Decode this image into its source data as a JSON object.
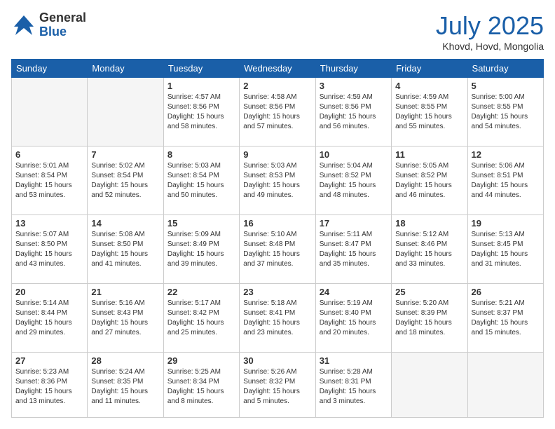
{
  "logo": {
    "general": "General",
    "blue": "Blue"
  },
  "header": {
    "month": "July 2025",
    "location": "Khovd, Hovd, Mongolia"
  },
  "weekdays": [
    "Sunday",
    "Monday",
    "Tuesday",
    "Wednesday",
    "Thursday",
    "Friday",
    "Saturday"
  ],
  "weeks": [
    [
      {
        "day": "",
        "sunrise": "",
        "sunset": "",
        "daylight": ""
      },
      {
        "day": "",
        "sunrise": "",
        "sunset": "",
        "daylight": ""
      },
      {
        "day": "1",
        "sunrise": "Sunrise: 4:57 AM",
        "sunset": "Sunset: 8:56 PM",
        "daylight": "Daylight: 15 hours and 58 minutes."
      },
      {
        "day": "2",
        "sunrise": "Sunrise: 4:58 AM",
        "sunset": "Sunset: 8:56 PM",
        "daylight": "Daylight: 15 hours and 57 minutes."
      },
      {
        "day": "3",
        "sunrise": "Sunrise: 4:59 AM",
        "sunset": "Sunset: 8:56 PM",
        "daylight": "Daylight: 15 hours and 56 minutes."
      },
      {
        "day": "4",
        "sunrise": "Sunrise: 4:59 AM",
        "sunset": "Sunset: 8:55 PM",
        "daylight": "Daylight: 15 hours and 55 minutes."
      },
      {
        "day": "5",
        "sunrise": "Sunrise: 5:00 AM",
        "sunset": "Sunset: 8:55 PM",
        "daylight": "Daylight: 15 hours and 54 minutes."
      }
    ],
    [
      {
        "day": "6",
        "sunrise": "Sunrise: 5:01 AM",
        "sunset": "Sunset: 8:54 PM",
        "daylight": "Daylight: 15 hours and 53 minutes."
      },
      {
        "day": "7",
        "sunrise": "Sunrise: 5:02 AM",
        "sunset": "Sunset: 8:54 PM",
        "daylight": "Daylight: 15 hours and 52 minutes."
      },
      {
        "day": "8",
        "sunrise": "Sunrise: 5:03 AM",
        "sunset": "Sunset: 8:54 PM",
        "daylight": "Daylight: 15 hours and 50 minutes."
      },
      {
        "day": "9",
        "sunrise": "Sunrise: 5:03 AM",
        "sunset": "Sunset: 8:53 PM",
        "daylight": "Daylight: 15 hours and 49 minutes."
      },
      {
        "day": "10",
        "sunrise": "Sunrise: 5:04 AM",
        "sunset": "Sunset: 8:52 PM",
        "daylight": "Daylight: 15 hours and 48 minutes."
      },
      {
        "day": "11",
        "sunrise": "Sunrise: 5:05 AM",
        "sunset": "Sunset: 8:52 PM",
        "daylight": "Daylight: 15 hours and 46 minutes."
      },
      {
        "day": "12",
        "sunrise": "Sunrise: 5:06 AM",
        "sunset": "Sunset: 8:51 PM",
        "daylight": "Daylight: 15 hours and 44 minutes."
      }
    ],
    [
      {
        "day": "13",
        "sunrise": "Sunrise: 5:07 AM",
        "sunset": "Sunset: 8:50 PM",
        "daylight": "Daylight: 15 hours and 43 minutes."
      },
      {
        "day": "14",
        "sunrise": "Sunrise: 5:08 AM",
        "sunset": "Sunset: 8:50 PM",
        "daylight": "Daylight: 15 hours and 41 minutes."
      },
      {
        "day": "15",
        "sunrise": "Sunrise: 5:09 AM",
        "sunset": "Sunset: 8:49 PM",
        "daylight": "Daylight: 15 hours and 39 minutes."
      },
      {
        "day": "16",
        "sunrise": "Sunrise: 5:10 AM",
        "sunset": "Sunset: 8:48 PM",
        "daylight": "Daylight: 15 hours and 37 minutes."
      },
      {
        "day": "17",
        "sunrise": "Sunrise: 5:11 AM",
        "sunset": "Sunset: 8:47 PM",
        "daylight": "Daylight: 15 hours and 35 minutes."
      },
      {
        "day": "18",
        "sunrise": "Sunrise: 5:12 AM",
        "sunset": "Sunset: 8:46 PM",
        "daylight": "Daylight: 15 hours and 33 minutes."
      },
      {
        "day": "19",
        "sunrise": "Sunrise: 5:13 AM",
        "sunset": "Sunset: 8:45 PM",
        "daylight": "Daylight: 15 hours and 31 minutes."
      }
    ],
    [
      {
        "day": "20",
        "sunrise": "Sunrise: 5:14 AM",
        "sunset": "Sunset: 8:44 PM",
        "daylight": "Daylight: 15 hours and 29 minutes."
      },
      {
        "day": "21",
        "sunrise": "Sunrise: 5:16 AM",
        "sunset": "Sunset: 8:43 PM",
        "daylight": "Daylight: 15 hours and 27 minutes."
      },
      {
        "day": "22",
        "sunrise": "Sunrise: 5:17 AM",
        "sunset": "Sunset: 8:42 PM",
        "daylight": "Daylight: 15 hours and 25 minutes."
      },
      {
        "day": "23",
        "sunrise": "Sunrise: 5:18 AM",
        "sunset": "Sunset: 8:41 PM",
        "daylight": "Daylight: 15 hours and 23 minutes."
      },
      {
        "day": "24",
        "sunrise": "Sunrise: 5:19 AM",
        "sunset": "Sunset: 8:40 PM",
        "daylight": "Daylight: 15 hours and 20 minutes."
      },
      {
        "day": "25",
        "sunrise": "Sunrise: 5:20 AM",
        "sunset": "Sunset: 8:39 PM",
        "daylight": "Daylight: 15 hours and 18 minutes."
      },
      {
        "day": "26",
        "sunrise": "Sunrise: 5:21 AM",
        "sunset": "Sunset: 8:37 PM",
        "daylight": "Daylight: 15 hours and 15 minutes."
      }
    ],
    [
      {
        "day": "27",
        "sunrise": "Sunrise: 5:23 AM",
        "sunset": "Sunset: 8:36 PM",
        "daylight": "Daylight: 15 hours and 13 minutes."
      },
      {
        "day": "28",
        "sunrise": "Sunrise: 5:24 AM",
        "sunset": "Sunset: 8:35 PM",
        "daylight": "Daylight: 15 hours and 11 minutes."
      },
      {
        "day": "29",
        "sunrise": "Sunrise: 5:25 AM",
        "sunset": "Sunset: 8:34 PM",
        "daylight": "Daylight: 15 hours and 8 minutes."
      },
      {
        "day": "30",
        "sunrise": "Sunrise: 5:26 AM",
        "sunset": "Sunset: 8:32 PM",
        "daylight": "Daylight: 15 hours and 5 minutes."
      },
      {
        "day": "31",
        "sunrise": "Sunrise: 5:28 AM",
        "sunset": "Sunset: 8:31 PM",
        "daylight": "Daylight: 15 hours and 3 minutes."
      },
      {
        "day": "",
        "sunrise": "",
        "sunset": "",
        "daylight": ""
      },
      {
        "day": "",
        "sunrise": "",
        "sunset": "",
        "daylight": ""
      }
    ]
  ]
}
